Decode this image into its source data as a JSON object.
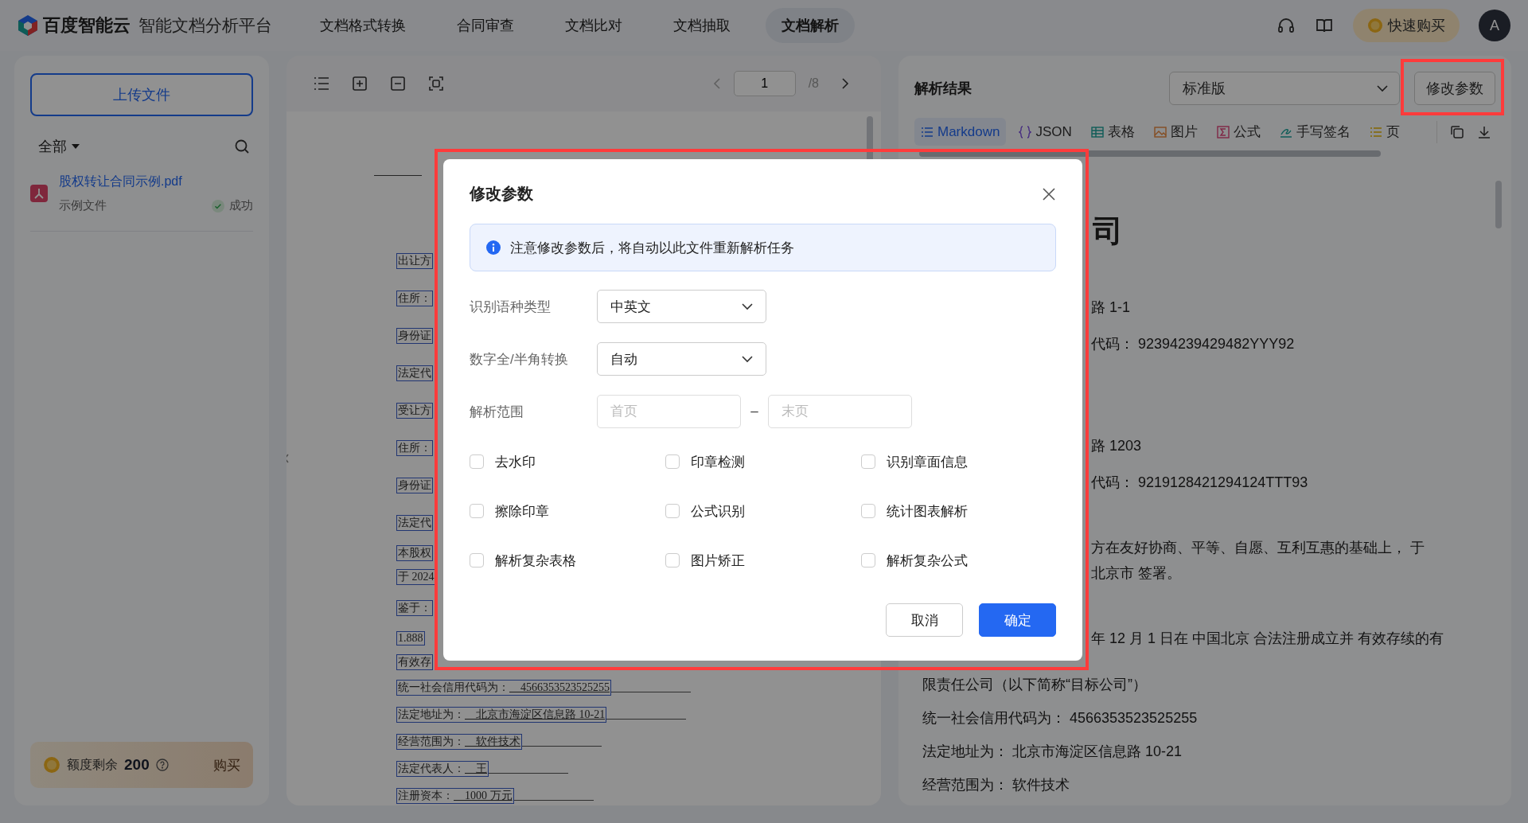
{
  "header": {
    "logo": "百度智能云",
    "product": "智能文档分析平台",
    "nav": [
      {
        "label": "文档格式转换",
        "selected": false
      },
      {
        "label": "合同审查",
        "selected": false
      },
      {
        "label": "文档比对",
        "selected": false
      },
      {
        "label": "文档抽取",
        "selected": false
      },
      {
        "label": "文档解析",
        "selected": true
      }
    ],
    "buy_button": "快速购买",
    "avatar": "A"
  },
  "sidebar": {
    "upload_button": "上传文件",
    "filter": "全部",
    "files": [
      {
        "name": "股权转让合同示例.pdf",
        "tag": "示例文件",
        "status": "成功"
      }
    ],
    "quota": {
      "label": "额度剩余",
      "value": "200",
      "buy_link": "购买"
    }
  },
  "viewer": {
    "page": "1",
    "page_total": "/8",
    "lines": [
      {
        "kind": "label",
        "text": "出让方"
      },
      {
        "kind": "label",
        "text": "住所："
      },
      {
        "kind": "label",
        "text": "身份证"
      },
      {
        "kind": "label",
        "text": "法定代"
      },
      {
        "kind": "label",
        "text": "受让方"
      },
      {
        "kind": "label",
        "text": "住所："
      },
      {
        "kind": "label",
        "text": "身份证"
      },
      {
        "kind": "label",
        "text": "法定代"
      },
      {
        "kind": "para",
        "text": "本股权"
      },
      {
        "kind": "para",
        "text": "于 2024"
      },
      {
        "kind": "label",
        "text": "鉴于："
      },
      {
        "kind": "para",
        "text": "1.888"
      },
      {
        "kind": "para",
        "text": "有效存"
      },
      {
        "kind": "entry",
        "text": "统一社会信用代码为：",
        "value": "4566353523525255"
      },
      {
        "kind": "entry",
        "text": "法定地址为：",
        "value": "北京市海淀区信息路 10-21"
      },
      {
        "kind": "entry",
        "text": "经营范围为：",
        "value": "软件技术"
      },
      {
        "kind": "entry",
        "text": "法定代表人：",
        "value": "王"
      },
      {
        "kind": "entry",
        "text": "注册资本：",
        "value": "1000 万元"
      }
    ]
  },
  "result": {
    "title": "解析结果",
    "edition": "标准版",
    "edit_button": "修改参数",
    "tabs": [
      {
        "kind": "markdown",
        "label": "Markdown",
        "selected": true
      },
      {
        "kind": "json",
        "label": "JSON",
        "selected": false
      },
      {
        "kind": "table",
        "label": "表格",
        "selected": false
      },
      {
        "kind": "image",
        "label": "图片",
        "selected": false
      },
      {
        "kind": "formula",
        "label": "公式",
        "selected": false
      },
      {
        "kind": "signature",
        "label": "手写签名",
        "selected": false
      },
      {
        "kind": "header",
        "label": "页",
        "selected": false
      }
    ],
    "lines": [
      {
        "kind": "heading",
        "text": "司"
      },
      {
        "kind": "start",
        "text": "路 1-1"
      },
      {
        "kind": "partial",
        "text": "代码：  92394239429482YYY92"
      },
      {
        "kind": "block",
        "text": "路 1203"
      },
      {
        "kind": "partial",
        "text": "代码：  9219128421294124TTT93"
      },
      {
        "kind": "start",
        "text": "方在友好协商、平等、自愿、互利互惠的基础上， 于"
      },
      {
        "kind": "tight",
        "text": "北京市 签署。"
      },
      {
        "kind": "start",
        "text": "年 12 月 1 日在 中国北京 合法注册成立并 有效存续的有"
      },
      {
        "kind": "below",
        "text": "限责任公司（以下简称“目标公司”）"
      },
      {
        "kind": "full",
        "text": "统一社会信用代码为：  4566353523525255"
      },
      {
        "kind": "full",
        "text": "法定地址为：  北京市海淀区信息路 10-21"
      },
      {
        "kind": "full",
        "text": "经营范围为：  软件技术"
      }
    ]
  },
  "dialog": {
    "title": "修改参数",
    "notice": "注意修改参数后，将自动以此文件重新解析任务",
    "fields": [
      {
        "kind": "select",
        "label": "识别语种类型",
        "value": "中英文"
      },
      {
        "kind": "select",
        "label": "数字全/半角转换",
        "value": "自动"
      },
      {
        "kind": "range",
        "label": "解析范围",
        "placeholder_from": "首页",
        "separator": "–",
        "placeholder_to": "末页"
      }
    ],
    "options": [
      {
        "label": "去水印",
        "checked": false
      },
      {
        "label": "印章检测",
        "checked": false
      },
      {
        "label": "识别章面信息",
        "checked": false
      },
      {
        "label": "擦除印章",
        "checked": false
      },
      {
        "label": "公式识别",
        "checked": false
      },
      {
        "label": "统计图表解析",
        "checked": false
      },
      {
        "label": "解析复杂表格",
        "checked": false
      },
      {
        "label": "图片矫正",
        "checked": false
      },
      {
        "label": "解析复杂公式",
        "checked": false
      }
    ],
    "buttons": [
      {
        "kind": "secondary",
        "label": "取消"
      },
      {
        "kind": "primary",
        "label": "确定"
      }
    ]
  }
}
